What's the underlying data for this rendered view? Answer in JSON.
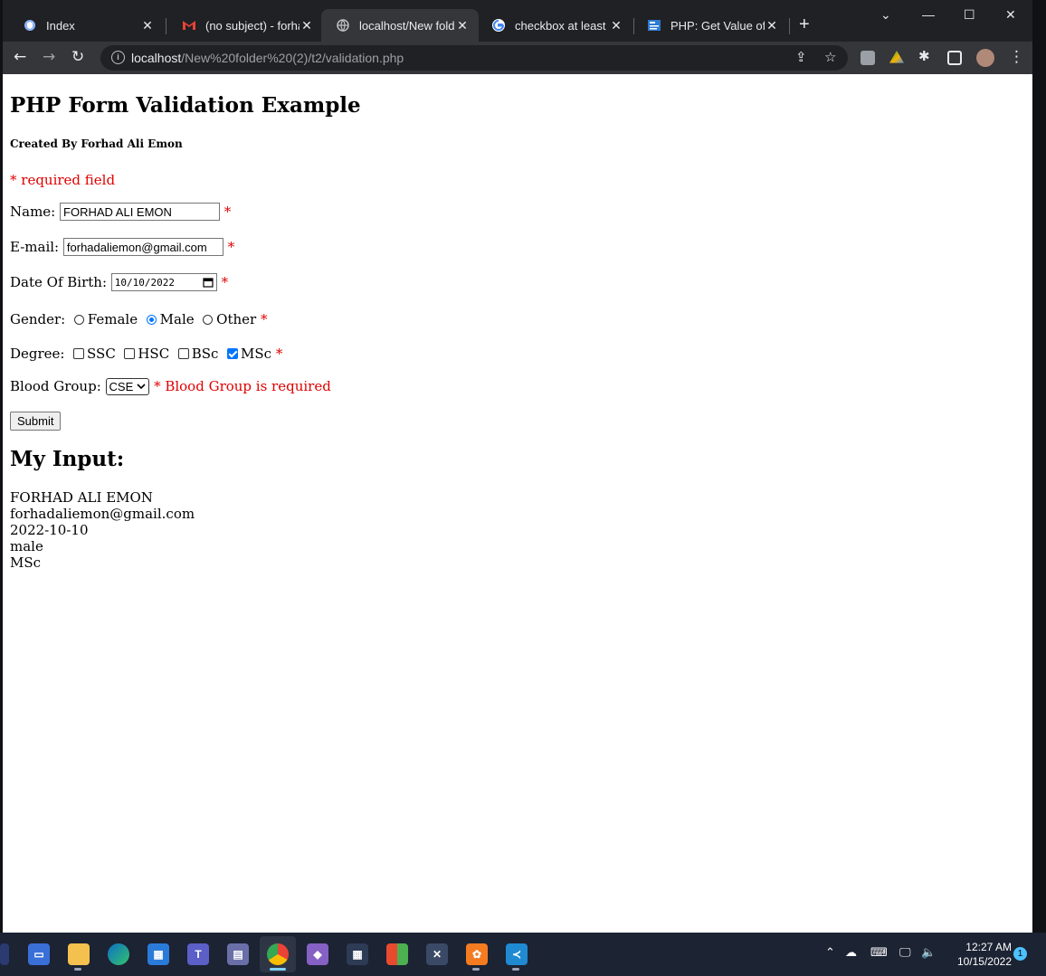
{
  "browser": {
    "tabs": [
      {
        "title": "Index",
        "icon": "shield-icon"
      },
      {
        "title": "(no subject) - forhad",
        "icon": "gmail-icon"
      },
      {
        "title": "localhost/New folde",
        "icon": "globe-icon"
      },
      {
        "title": "checkbox at least tw",
        "icon": "google-icon"
      },
      {
        "title": "PHP: Get Value of Se",
        "icon": "doc-icon"
      }
    ],
    "active_tab": 2,
    "url_host": "localhost",
    "url_path": "/New%20folder%20(2)/t2/validation.php"
  },
  "page": {
    "title": "PHP Form Validation Example",
    "subtitle": "Created By Forhad Ali Emon",
    "required_note": "* required field",
    "asterisk": "*",
    "name_label": "Name:",
    "name_value": "FORHAD ALI EMON",
    "email_label": "E-mail:",
    "email_value": "forhadaliemon@gmail.com",
    "dob_label": "Date Of Birth:",
    "dob_value": "10/10/2022",
    "gender_label": "Gender:",
    "gender_options": [
      {
        "label": "Female",
        "checked": false
      },
      {
        "label": "Male",
        "checked": true
      },
      {
        "label": "Other",
        "checked": false
      }
    ],
    "degree_label": "Degree:",
    "degree_options": [
      {
        "label": "SSC",
        "checked": false
      },
      {
        "label": "HSC",
        "checked": false
      },
      {
        "label": "BSc",
        "checked": false
      },
      {
        "label": "MSc",
        "checked": true
      }
    ],
    "blood_label": "Blood Group:",
    "blood_value": "CSE",
    "blood_error": "* Blood Group is required",
    "submit_label": "Submit",
    "output_heading": "My Input:",
    "output_lines": [
      "FORHAD ALI EMON",
      "forhadaliemon@gmail.com",
      "2022-10-10",
      "male",
      "MSc"
    ]
  },
  "taskbar": {
    "time": "12:27 AM",
    "date": "10/15/2022",
    "notifications": "1"
  }
}
